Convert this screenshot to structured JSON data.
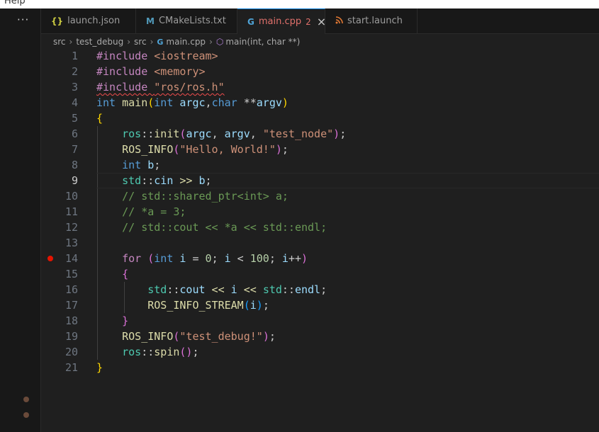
{
  "menu": {
    "help_label": "Help"
  },
  "tabs": [
    {
      "icon": "{}",
      "label": "launch.json"
    },
    {
      "icon": "M",
      "label": "CMakeLists.txt"
    },
    {
      "icon": "G",
      "label": "main.cpp",
      "badge": "2"
    },
    {
      "icon": "rss",
      "label": "start.launch"
    }
  ],
  "more_label": "···",
  "breadcrumb": {
    "parts": [
      "src",
      "test_debug",
      "src",
      "main.cpp",
      "main(int, char **)"
    ]
  },
  "editor": {
    "current_line": 9,
    "breakpoint_line": 14,
    "line_numbers": [
      "1",
      "2",
      "3",
      "4",
      "5",
      "6",
      "7",
      "8",
      "9",
      "10",
      "11",
      "12",
      "13",
      "14",
      "15",
      "16",
      "17",
      "18",
      "19",
      "20",
      "21"
    ],
    "lines": [
      [
        [
          "pp",
          "#include "
        ],
        [
          "str",
          "<iostream>"
        ]
      ],
      [
        [
          "pp",
          "#include "
        ],
        [
          "str",
          "<memory>"
        ]
      ],
      [
        [
          "pp squig",
          "#include "
        ],
        [
          "str squig",
          "\"ros/ros.h\""
        ]
      ],
      [
        [
          "kw",
          "int "
        ],
        [
          "fn",
          "main"
        ],
        [
          "b1",
          "("
        ],
        [
          "kw",
          "int "
        ],
        [
          "var",
          "argc"
        ],
        [
          "",
          ","
        ],
        [
          "kw",
          "char "
        ],
        [
          "",
          "**"
        ],
        [
          "var",
          "argv"
        ],
        [
          "b1",
          ")"
        ]
      ],
      [
        [
          "b1",
          "{"
        ]
      ],
      [
        [
          "",
          "    "
        ],
        [
          "ns",
          "ros"
        ],
        [
          "",
          "::"
        ],
        [
          "fn",
          "init"
        ],
        [
          "b2",
          "("
        ],
        [
          "var",
          "argc"
        ],
        [
          "",
          ", "
        ],
        [
          "var",
          "argv"
        ],
        [
          "",
          ", "
        ],
        [
          "str",
          "\"test_node\""
        ],
        [
          "b2",
          ")"
        ],
        [
          "",
          ";"
        ]
      ],
      [
        [
          "",
          "    "
        ],
        [
          "fn",
          "ROS_INFO"
        ],
        [
          "b2",
          "("
        ],
        [
          "str",
          "\"Hello, World!\""
        ],
        [
          "b2",
          ")"
        ],
        [
          "",
          ";"
        ]
      ],
      [
        [
          "",
          "    "
        ],
        [
          "kw",
          "int "
        ],
        [
          "var",
          "b"
        ],
        [
          "",
          ";"
        ]
      ],
      [
        [
          "",
          "    "
        ],
        [
          "ns",
          "std"
        ],
        [
          "",
          "::"
        ],
        [
          "var",
          "cin"
        ],
        [
          "fn",
          " >> "
        ],
        [
          "var",
          "b"
        ],
        [
          "",
          ";"
        ]
      ],
      [
        [
          "",
          "    "
        ],
        [
          "cm",
          "// std::shared_ptr<int> a;"
        ]
      ],
      [
        [
          "",
          "    "
        ],
        [
          "cm",
          "// *a = 3;"
        ]
      ],
      [
        [
          "",
          "    "
        ],
        [
          "cm",
          "// std::cout << *a << std::endl;"
        ]
      ],
      [],
      [
        [
          "",
          "    "
        ],
        [
          "pp",
          "for "
        ],
        [
          "b2",
          "("
        ],
        [
          "kw",
          "int "
        ],
        [
          "var",
          "i"
        ],
        [
          "",
          " = "
        ],
        [
          "num",
          "0"
        ],
        [
          "",
          "; "
        ],
        [
          "var",
          "i"
        ],
        [
          "",
          " < "
        ],
        [
          "num",
          "100"
        ],
        [
          "",
          "; "
        ],
        [
          "var",
          "i"
        ],
        [
          "",
          "++"
        ],
        [
          "b2",
          ")"
        ]
      ],
      [
        [
          "",
          "    "
        ],
        [
          "b2",
          "{"
        ]
      ],
      [
        [
          "",
          "        "
        ],
        [
          "ns",
          "std"
        ],
        [
          "",
          "::"
        ],
        [
          "var",
          "cout"
        ],
        [
          "fn",
          " << "
        ],
        [
          "var",
          "i"
        ],
        [
          "fn",
          " << "
        ],
        [
          "ns",
          "std"
        ],
        [
          "",
          "::"
        ],
        [
          "var",
          "endl"
        ],
        [
          "",
          ";"
        ]
      ],
      [
        [
          "",
          "        "
        ],
        [
          "fn",
          "ROS_INFO_STREAM"
        ],
        [
          "b3",
          "("
        ],
        [
          "var",
          "i"
        ],
        [
          "b3",
          ")"
        ],
        [
          "",
          ";"
        ]
      ],
      [
        [
          "",
          "    "
        ],
        [
          "b2",
          "}"
        ]
      ],
      [
        [
          "",
          "    "
        ],
        [
          "fn",
          "ROS_INFO"
        ],
        [
          "b2",
          "("
        ],
        [
          "str",
          "\"test_debug!\""
        ],
        [
          "b2",
          ")"
        ],
        [
          "",
          ";"
        ]
      ],
      [
        [
          "",
          "    "
        ],
        [
          "ns",
          "ros"
        ],
        [
          "",
          "::"
        ],
        [
          "fn",
          "spin"
        ],
        [
          "b2",
          "()"
        ],
        [
          "",
          ";"
        ]
      ],
      [
        [
          "b1",
          "}"
        ]
      ]
    ]
  }
}
